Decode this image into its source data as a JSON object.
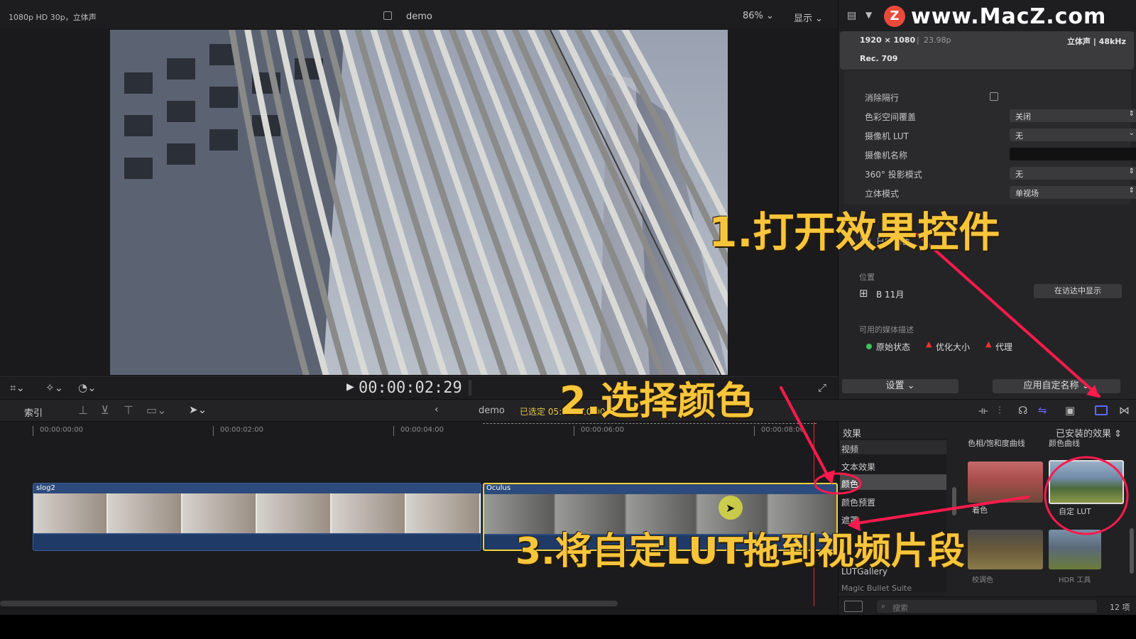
{
  "viewer": {
    "format_label": "1080p HD 30p，立体声",
    "project_name": "demo",
    "zoom_level": "86%",
    "display_menu": "显示",
    "timecode": "00:00:02:29"
  },
  "inspector": {
    "watermark": "www.MacZ.com",
    "resolution": "1920 × 1080",
    "framerate": "23.98p",
    "audio_info": "立体声 | 48kHz",
    "color_space": "Rec. 709",
    "rows": [
      {
        "label": "消除隔行",
        "type": "checkbox"
      },
      {
        "label": "色彩空间覆盖",
        "value": "关闭"
      },
      {
        "label": "摄像机 LUT",
        "value": "无"
      },
      {
        "label": "摄像机名称",
        "value": ""
      },
      {
        "label": "360° 投影模式",
        "value": "无"
      },
      {
        "label": "立体模式",
        "value": "单视场"
      }
    ],
    "role_label": "日常调色",
    "location_heading": "位置",
    "location_value": "B 11月",
    "show_in_finder": "在访达中显示",
    "media_heading": "可用的媒体描述",
    "media_states": [
      "原始状态",
      "优化大小",
      "代理"
    ],
    "settings_button": "设置",
    "apply_button": "应用自定名称"
  },
  "timeline": {
    "index_label": "索引",
    "project_name": "demo",
    "selected_info": "已选定 05:00 / 10:00",
    "ruler": [
      "00:00:00:00",
      "00:00:02:00",
      "00:00:04:00",
      "00:00:06:00",
      "00:00:08:00"
    ],
    "clips": [
      {
        "name": "slog2"
      },
      {
        "name": "Oculus"
      }
    ]
  },
  "effects": {
    "header": "效果",
    "installed": "已安装的效果",
    "categories": [
      "视频",
      "文本效果",
      "颜色",
      "颜色预置",
      "遮罩",
      "LUTGallery",
      "Magic Bullet Suite"
    ],
    "selected_category": "颜色",
    "top_labels": [
      "色相/饱和度曲线",
      "颜色曲线"
    ],
    "items": [
      {
        "name": "着色"
      },
      {
        "name": "自定 LUT"
      },
      {
        "name": "校调色"
      },
      {
        "name": "HDR 工具"
      }
    ],
    "search_placeholder": "搜索",
    "count": "12 项"
  },
  "annotations": {
    "step1": "1.打开效果控件",
    "step2": "2.选择颜色",
    "step3": "3.将自定LUT拖到视频片段"
  },
  "colors": {
    "accent_annot": "#f7c53b",
    "arrow_red": "#ff1a4d",
    "clip_blue": "#2c4a7c",
    "selected_yellow": "#f4d03f"
  }
}
